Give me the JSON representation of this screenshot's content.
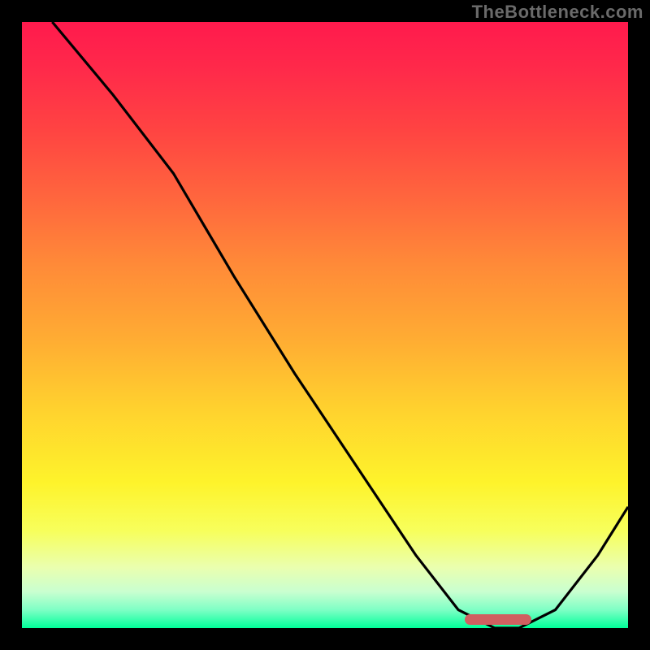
{
  "watermark": "TheBottleneck.com",
  "chart_data": {
    "type": "line",
    "title": "",
    "xlabel": "",
    "ylabel": "",
    "xlim": [
      0,
      100
    ],
    "ylim": [
      0,
      100
    ],
    "grid": false,
    "legend": false,
    "background": "red-yellow-green vertical gradient (red top, green bottom)",
    "series": [
      {
        "name": "bottleneck-curve",
        "color": "#000000",
        "x": [
          5,
          15,
          25,
          35,
          45,
          55,
          65,
          72,
          78,
          82,
          88,
          95,
          100
        ],
        "y": [
          100,
          88,
          75,
          58,
          42,
          27,
          12,
          3,
          0,
          0,
          3,
          12,
          20
        ]
      }
    ],
    "annotations": [
      {
        "name": "optimal-range-marker",
        "type": "bar",
        "color": "#d06060",
        "x_start": 73,
        "x_end": 84,
        "y": 1
      }
    ]
  },
  "colors": {
    "frame": "#000000",
    "gradient_top": "#ff1a4d",
    "gradient_mid": "#fef32b",
    "gradient_bottom": "#00ff99",
    "curve": "#000000",
    "marker": "#d06060",
    "watermark": "#6a6a6a"
  }
}
